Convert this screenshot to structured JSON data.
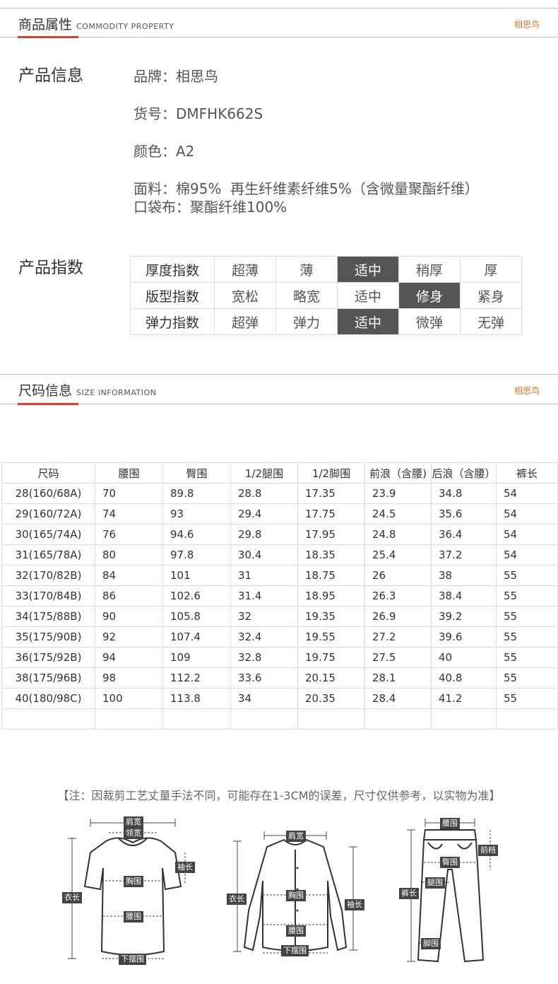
{
  "section1": {
    "title": "商品属性",
    "subtitle": "COMMODITY PROPERTY",
    "brand": "相思鸟"
  },
  "product_info": {
    "heading": "产品信息",
    "lines": [
      "品牌：相思鸟",
      "货号：DMFHK662S",
      "颜色：A2",
      "面料：棉95%  再生纤维素纤维5%（含微量聚酯纤维）",
      "口袋布：聚酯纤维100%"
    ]
  },
  "product_index": {
    "heading": "产品指数",
    "rows": [
      {
        "label": "厚度指数",
        "options": [
          "超薄",
          "薄",
          "适中",
          "稍厚",
          "厚"
        ],
        "selected": 2
      },
      {
        "label": "版型指数",
        "options": [
          "宽松",
          "略宽",
          "适中",
          "修身",
          "紧身"
        ],
        "selected": 3
      },
      {
        "label": "弹力指数",
        "options": [
          "超弹",
          "弹力",
          "适中",
          "微弹",
          "无弹"
        ],
        "selected": 2
      }
    ]
  },
  "section2": {
    "title": "尺码信息",
    "subtitle": "SIZE INFORMATION",
    "brand": "相思鸟"
  },
  "size_table": {
    "headers": [
      "尺码",
      "腰围",
      "臀围",
      "1/2腿围",
      "1/2脚围",
      "前浪（含腰)",
      "后浪（含腰）",
      "裤长"
    ],
    "rows": [
      [
        "28(160/68A)",
        "70",
        "89.8",
        "28.8",
        "17.35",
        "23.9",
        "34.8",
        "54"
      ],
      [
        "29(160/72A)",
        "74",
        "93",
        "29.4",
        "17.75",
        "24.5",
        "35.6",
        "54"
      ],
      [
        "30(165/74A)",
        "76",
        "94.6",
        "29.8",
        "17.95",
        "24.8",
        "36.4",
        "54"
      ],
      [
        "31(165/78A)",
        "80",
        "97.8",
        "30.4",
        "18.35",
        "25.4",
        "37.2",
        "54"
      ],
      [
        "32(170/82B)",
        "84",
        "101",
        "31",
        "18.75",
        "26",
        "38",
        "55"
      ],
      [
        "33(170/84B)",
        "86",
        "102.6",
        "31.4",
        "18.95",
        "26.3",
        "38.4",
        "55"
      ],
      [
        "34(175/88B)",
        "90",
        "105.8",
        "32",
        "19.35",
        "26.9",
        "39.2",
        "55"
      ],
      [
        "35(175/90B)",
        "92",
        "107.4",
        "32.4",
        "19.55",
        "27.2",
        "39.6",
        "55"
      ],
      [
        "36(175/92B)",
        "94",
        "109",
        "32.8",
        "19.75",
        "27.5",
        "40",
        "55"
      ],
      [
        "38(175/96B)",
        "98",
        "112.2",
        "33.6",
        "20.15",
        "28.1",
        "40.8",
        "55"
      ],
      [
        "40(180/98C)",
        "100",
        "113.8",
        "34",
        "20.35",
        "28.4",
        "41.2",
        "55"
      ],
      [
        "",
        "",
        "",
        "",
        "",
        "",
        "",
        ""
      ]
    ]
  },
  "note": "【注：因裁剪工艺丈量手法不同，可能存在1-3CM的误差，尺寸仅供参考，以实物为准】",
  "diagrams": {
    "tshirt": {
      "shoulder": "肩宽",
      "neck": "领宽",
      "sleeve": "袖长",
      "chest": "胸围",
      "length": "衣长",
      "waist": "腰围",
      "hem": "下摆围"
    },
    "shirt": {
      "shoulder": "肩宽",
      "chest": "胸围",
      "length": "衣长",
      "sleeve": "袖长",
      "waist": "腰围",
      "hem": "下摆围"
    },
    "pants": {
      "waist": "腰围",
      "rise": "前档",
      "hip": "臀围",
      "thigh": "腿围",
      "length": "裤长",
      "foot": "脚围"
    }
  }
}
